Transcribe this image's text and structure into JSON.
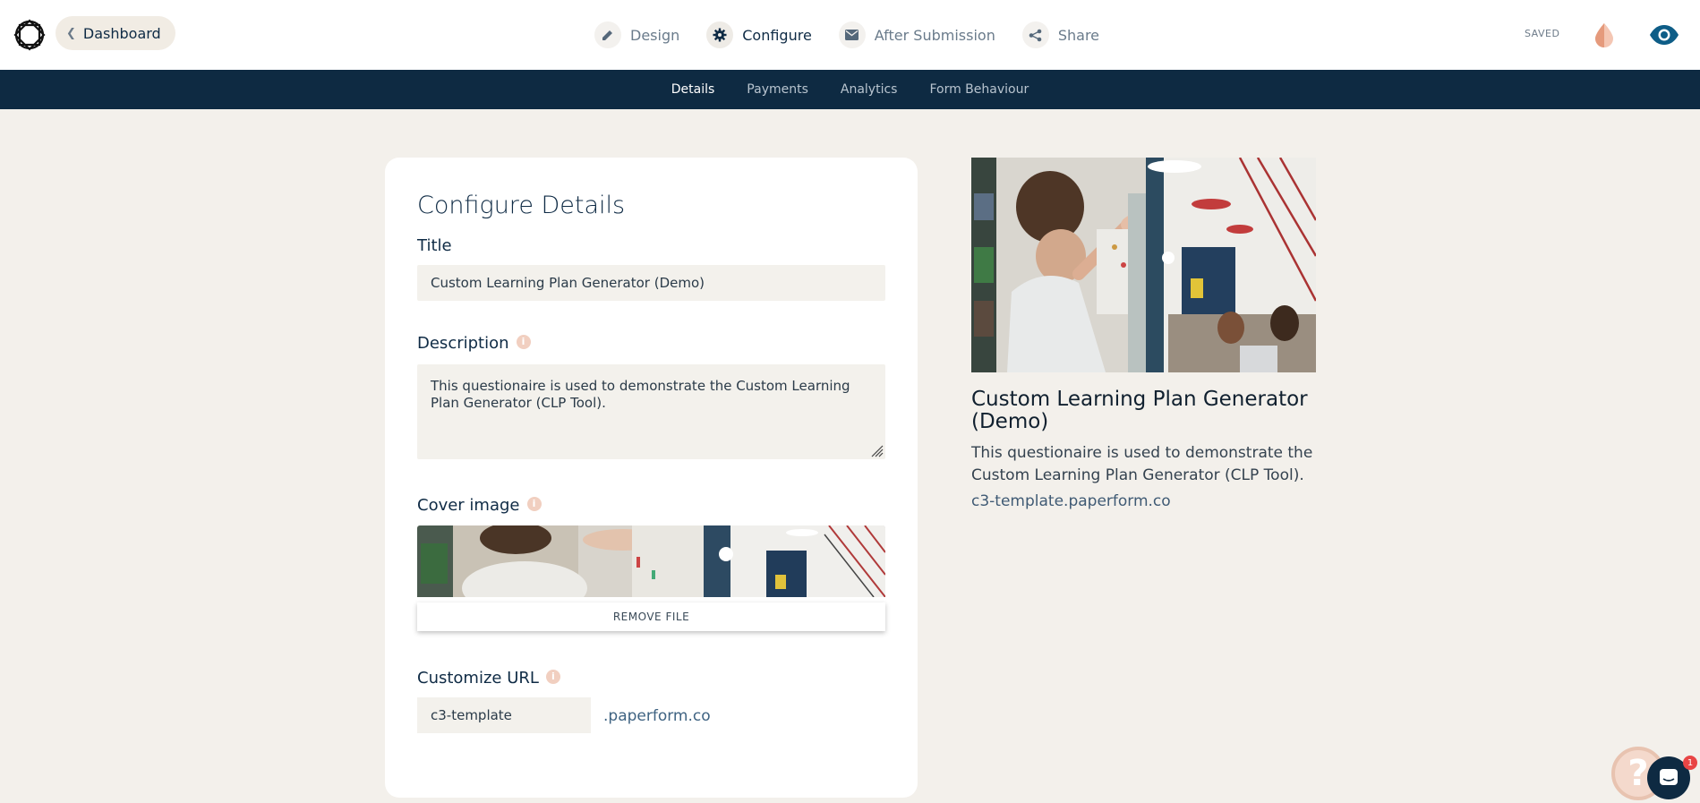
{
  "header": {
    "dashboard_label": "Dashboard",
    "tabs": [
      {
        "label": "Design",
        "icon": "pencil-icon"
      },
      {
        "label": "Configure",
        "icon": "gear-icon"
      },
      {
        "label": "After Submission",
        "icon": "envelope-icon"
      },
      {
        "label": "Share",
        "icon": "share-icon"
      }
    ],
    "active_tab": "Configure",
    "saved_status": "SAVED"
  },
  "subnav": {
    "tabs": [
      "Details",
      "Payments",
      "Analytics",
      "Form Behaviour"
    ],
    "active": "Details"
  },
  "form": {
    "heading": "Configure Details",
    "title_label": "Title",
    "title_value": "Custom Learning Plan Generator (Demo)",
    "description_label": "Description",
    "description_value": "This questionaire is used to demonstrate the Custom Learning Plan Generator (CLP Tool).",
    "cover_label": "Cover image",
    "remove_label": "REMOVE FILE",
    "url_label": "Customize URL",
    "url_value": "c3-template",
    "url_suffix": ".paperform.co"
  },
  "preview": {
    "title": "Custom Learning Plan Generator (Demo)",
    "description": "This questionaire is used to demonstrate the Custom Learning Plan Generator (CLP Tool).",
    "url": "c3-template.paperform.co"
  },
  "widgets": {
    "help_glyph": "?",
    "chat_badge": "1"
  },
  "colors": {
    "navy": "#0e2a42",
    "accent_peach": "#e8a58c",
    "page_bg": "#f3f0eb"
  }
}
